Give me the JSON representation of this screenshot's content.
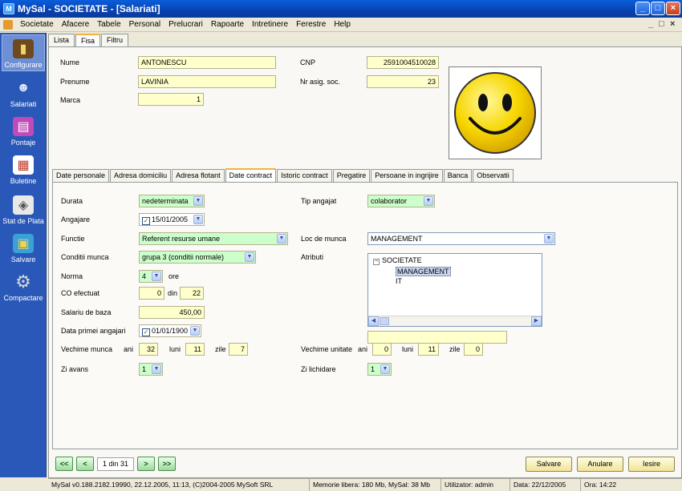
{
  "window": {
    "title": "MySal - SOCIETATE - [Salariati]"
  },
  "menu": [
    "Societate",
    "Afacere",
    "Tabele",
    "Personal",
    "Prelucrari",
    "Rapoarte",
    "Intretinere",
    "Ferestre",
    "Help"
  ],
  "sidebar": [
    {
      "label": "Configurare",
      "icon": "book-icon"
    },
    {
      "label": "Salariati",
      "icon": "people-icon"
    },
    {
      "label": "Pontaje",
      "icon": "clipboard-icon"
    },
    {
      "label": "Buletine",
      "icon": "document-icon"
    },
    {
      "label": "Stat de Plata",
      "icon": "payroll-icon"
    },
    {
      "label": "Salvare",
      "icon": "save-icon"
    },
    {
      "label": "Compactare",
      "icon": "gear-icon"
    }
  ],
  "tabs": [
    "Lista",
    "Fisa",
    "Filtru"
  ],
  "person": {
    "nume_label": "Nume",
    "nume": "ANTONESCU",
    "prenume_label": "Prenume",
    "prenume": "LAVINIA",
    "marca_label": "Marca",
    "marca": "1",
    "cnp_label": "CNP",
    "cnp": "2591004510028",
    "asig_label": "Nr asig. soc.",
    "asig": "23"
  },
  "subtabs": [
    "Date personale",
    "Adresa domiciliu",
    "Adresa flotant",
    "Date contract",
    "Istoric contract",
    "Pregatire",
    "Persoane in ingrijire",
    "Banca",
    "Observatii"
  ],
  "contract": {
    "durata_label": "Durata",
    "durata": "nedeterminata",
    "angajare_label": "Angajare",
    "angajare": "15/01/2005",
    "functie_label": "Functie",
    "functie": "Referent resurse umane",
    "conditii_label": "Conditii munca",
    "conditii": "grupa 3 (conditii normale)",
    "norma_label": "Norma",
    "norma": "4",
    "ore": "ore",
    "co_label": "CO efectuat",
    "co": "0",
    "din": "din",
    "co_total": "22",
    "salariu_label": "Salariu de baza",
    "salariu": "450,00",
    "data_prima_label": "Data primei angajari",
    "data_prima": "01/01/1900",
    "vechime_label": "Vechime munca",
    "ani": "ani",
    "luni": "luni",
    "zile": "zile",
    "vechime_ani": "32",
    "vechime_luni": "11",
    "vechime_zile": "7",
    "zi_avans_label": "Zi avans",
    "zi_avans": "1",
    "tip_label": "Tip angajat",
    "tip": "colaborator",
    "loc_label": "Loc de munca",
    "loc": "MANAGEMENT",
    "atributi_label": "Atributi",
    "tree": [
      "SOCIETATE",
      "MANAGEMENT",
      "IT"
    ],
    "vech_unit_label": "Vechime unitate",
    "vu_ani": "0",
    "vu_luni": "11",
    "vu_zile": "0",
    "zi_lich_label": "Zi lichidare",
    "zi_lich": "1"
  },
  "nav": {
    "first": "<<",
    "prev": "<",
    "record": "1 din 31",
    "next": ">",
    "last": ">>"
  },
  "actions": {
    "save": "Salvare",
    "cancel": "Anulare",
    "exit": "Iesire"
  },
  "status": [
    "MySal v0.188.2182.19990, 22.12.2005, 11:13, (C)2004-2005 MySoft SRL",
    "Memorie libera: 180 Mb, MySal: 38 Mb",
    "Utilizator: admin",
    "Data: 22/12/2005",
    "Ora: 14:22"
  ]
}
